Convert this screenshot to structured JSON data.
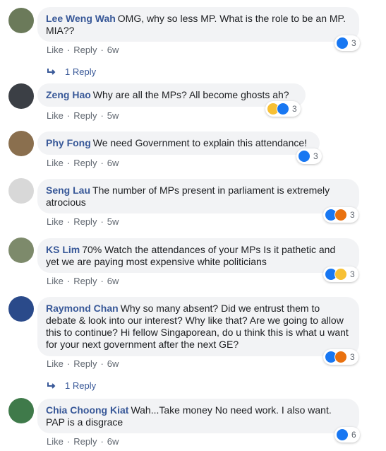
{
  "comments": [
    {
      "author": "Lee Weng Wah",
      "text": "OMG, why so less MP. What is the role to be an MP. MIA??",
      "like": "Like",
      "reply": "Reply",
      "time": "6w",
      "reaction_count": "3",
      "reactions": [
        "like-icon"
      ],
      "avatar_color": "#6b7a5a"
    },
    {
      "author": "Zeng Hao",
      "text": "Why are all the MPs? All become ghosts ah?",
      "like": "Like",
      "reply": "Reply",
      "time": "5w",
      "reaction_count": "3",
      "reactions": [
        "haha-icon",
        "like-icon"
      ],
      "avatar_color": "#3b3f45"
    },
    {
      "author": "Phy Fong",
      "text": "We need Government to explain this attendance!",
      "like": "Like",
      "reply": "Reply",
      "time": "6w",
      "reaction_count": "3",
      "reactions": [
        "like-icon"
      ],
      "avatar_color": "#8a6f4e"
    },
    {
      "author": "Seng Lau",
      "text": "The number of MPs present in parliament is extremely atrocious",
      "like": "Like",
      "reply": "Reply",
      "time": "5w",
      "reaction_count": "3",
      "reactions": [
        "like-icon",
        "angry-icon"
      ],
      "avatar_color": "#d8d8d8"
    },
    {
      "author": "KS Lim",
      "text": "70% Watch the attendances of your MPs Is it pathetic and yet we are paying most expensive white politicians",
      "like": "Like",
      "reply": "Reply",
      "time": "6w",
      "reaction_count": "3",
      "reactions": [
        "like-icon",
        "haha-icon"
      ],
      "avatar_color": "#7d8a6b"
    },
    {
      "author": "Raymond Chan",
      "text": "Why so many absent? Did we entrust them to debate & look into our interest? Why like that? Are we going to allow this to continue? Hi fellow Singaporean, do u think this is what u want for your next government after the next GE?",
      "like": "Like",
      "reply": "Reply",
      "time": "6w",
      "reaction_count": "3",
      "reactions": [
        "like-icon",
        "angry-icon"
      ],
      "avatar_color": "#2a4a8a"
    },
    {
      "author": "Chia Choong Kiat",
      "text": "Wah...Take money No need work. I also want. PAP is a disgrace",
      "like": "Like",
      "reply": "Reply",
      "time": "6w",
      "reaction_count": "6",
      "reactions": [
        "like-icon"
      ],
      "avatar_color": "#3f7a4a"
    }
  ],
  "replies": [
    {
      "label": "1 Reply"
    },
    {
      "label": "1 Reply"
    }
  ],
  "colors": {
    "like": "#1877f2",
    "haha": "#f7c034",
    "angry": "#e9710f",
    "link": "#385898"
  }
}
